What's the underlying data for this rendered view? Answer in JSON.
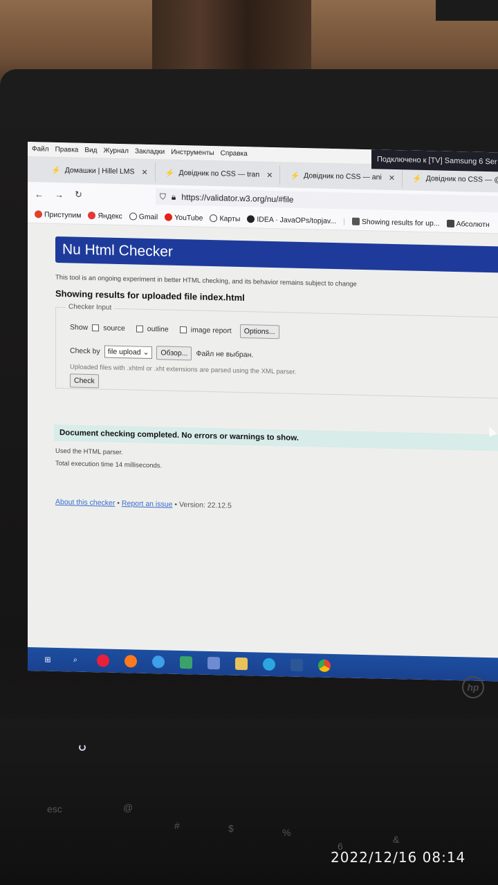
{
  "menubar": {
    "items": [
      "Файл",
      "Правка",
      "Вид",
      "Журнал",
      "Закладки",
      "Инструменты",
      "Справка"
    ],
    "cast": "Подключено к [TV] Samsung 6 Ser"
  },
  "tabs": [
    {
      "label": "Домашки | Hillel LMS",
      "icon": "hillel-icon"
    },
    {
      "label": "Довідник по CSS — tran",
      "icon": "css-ref-icon"
    },
    {
      "label": "Довідник по CSS — ani",
      "icon": "css-ref-icon"
    },
    {
      "label": "Довідник по CSS — @k",
      "icon": "css-ref-icon"
    }
  ],
  "nav": {
    "url": "https://validator.w3.org/nu/#file"
  },
  "bookmarks": [
    {
      "label": "Приступим",
      "color": "#e0412b"
    },
    {
      "label": "Яндекс",
      "color": "#e53935"
    },
    {
      "label": "Gmail",
      "color": "#444444"
    },
    {
      "label": "YouTube",
      "color": "#e62117"
    },
    {
      "label": "Карты",
      "color": "#444444"
    },
    {
      "label": "IDEA · JavaOPs/topjav...",
      "color": "#222222"
    },
    {
      "label": "Showing results for up...",
      "color": "#333333"
    },
    {
      "label": "Абсолютн",
      "color": "#333333"
    }
  ],
  "page": {
    "header": "Nu Html Checker",
    "intro": "This tool is an ongoing experiment in better HTML checking, and its behavior remains subject to change",
    "results_title": "Showing results for uploaded file index.html",
    "legend": "Checker Input",
    "show_label": "Show",
    "opt_source": "source",
    "opt_outline": "outline",
    "opt_image_report": "image report",
    "options_button": "Options...",
    "check_by_label": "Check by",
    "check_by_value": "file upload",
    "browse_button": "Обзор...",
    "no_file": "Файл не выбран.",
    "xml_note": "Uploaded files with .xhtml or .xht extensions are parsed using the XML parser.",
    "check_button": "Check",
    "completed": "Document checking completed. No errors or warnings to show.",
    "used_parser": "Used the HTML parser.",
    "exec_time": "Total execution time 14 milliseconds.",
    "about_link": "About this checker",
    "sep1": " • ",
    "report_link": "Report an issue",
    "version": " • Version: 22.12.5"
  },
  "timestamp": "2022/12/16  08:14",
  "brand": "hp"
}
